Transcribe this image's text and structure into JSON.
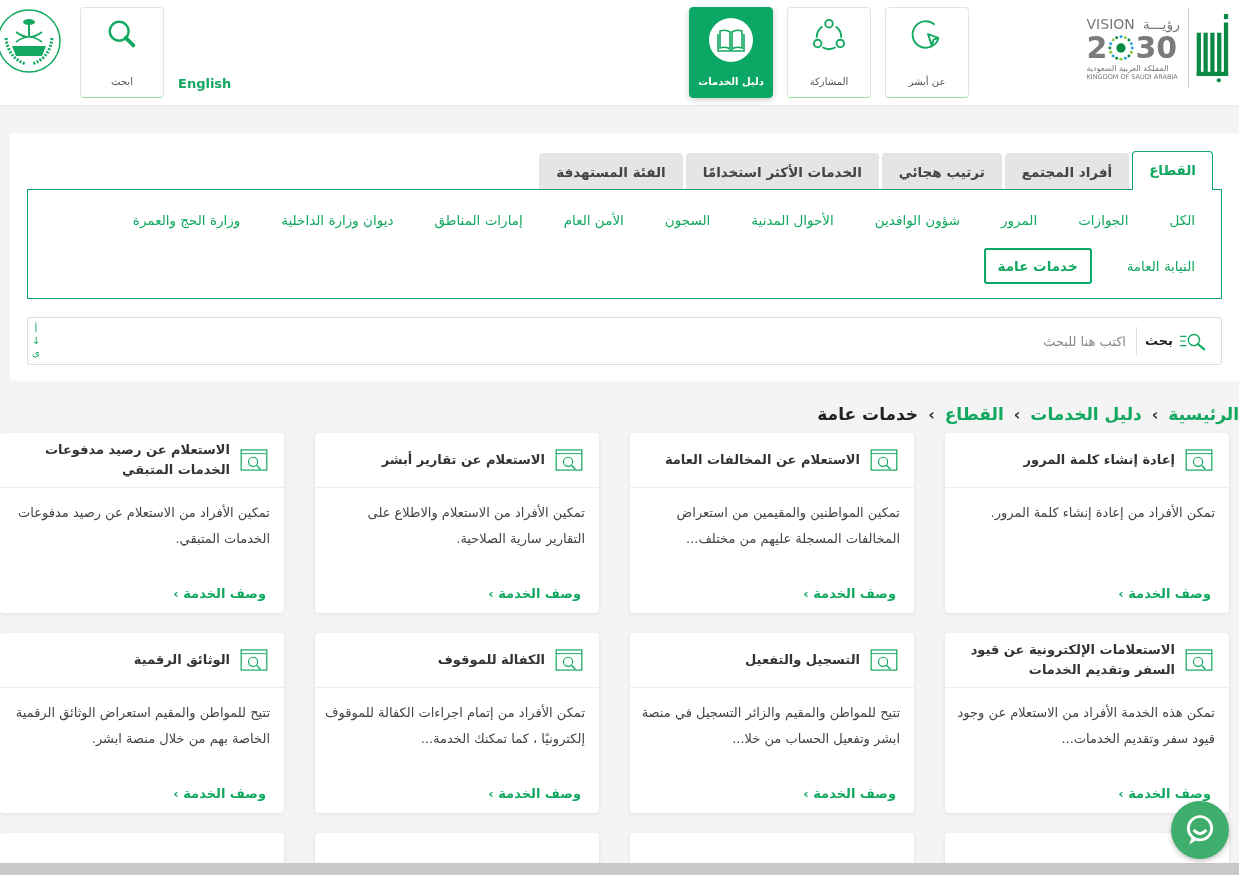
{
  "header": {
    "logo": {
      "vision_word": "VISION",
      "vision_arabic": "رؤيـــة",
      "year_start": "2",
      "year_end": "30",
      "country_arabic": "المملكة العربية السعودية",
      "country_english": "KINGDOM OF SAUDI ARABIA"
    },
    "nav": [
      {
        "label": "عن أبشر",
        "kind": "cursor",
        "selected": false
      },
      {
        "label": "المشاركة",
        "kind": "share",
        "selected": false
      },
      {
        "label": "دليل الخدمات",
        "kind": "book",
        "selected": true
      }
    ],
    "language_link": "English",
    "search_button": "ابحث"
  },
  "tabs": [
    {
      "label": "القطاع",
      "selected": true
    },
    {
      "label": "أفراد المجتمع",
      "selected": false
    },
    {
      "label": "ترتيب هجائي",
      "selected": false
    },
    {
      "label": "الخدمات الأكثر استخدامًا",
      "selected": false
    },
    {
      "label": "الفئة المستهدفة",
      "selected": false
    }
  ],
  "sectors": [
    {
      "label": "الكل",
      "selected": false
    },
    {
      "label": "الجوازات",
      "selected": false
    },
    {
      "label": "المرور",
      "selected": false
    },
    {
      "label": "شؤون الوافدين",
      "selected": false
    },
    {
      "label": "الأحوال المدنية",
      "selected": false
    },
    {
      "label": "السجون",
      "selected": false
    },
    {
      "label": "الأمن العام",
      "selected": false
    },
    {
      "label": "إمارات المناطق",
      "selected": false
    },
    {
      "label": "ديوان وزارة الداخلية",
      "selected": false
    },
    {
      "label": "وزارة الحج والعمرة",
      "selected": false
    },
    {
      "label": "النيابة العامة",
      "selected": false
    },
    {
      "label": "خدمات عامة",
      "selected": true
    }
  ],
  "search": {
    "label": "بحث",
    "placeholder": "اكتب هنا للبحث",
    "sort": [
      "أ",
      "↓",
      "ى"
    ]
  },
  "breadcrumb": [
    {
      "label": "الرئيسية",
      "current": false
    },
    {
      "label": "دليل الخدمات",
      "current": false
    },
    {
      "label": "القطاع",
      "current": false
    },
    {
      "label": "خدمات عامة",
      "current": true
    }
  ],
  "breadcrumb_separator": "›",
  "cards": [
    {
      "title": "إعادة إنشاء كلمة المرور",
      "description": "تمكن الأفراد من إعادة إنشاء كلمة المرور.",
      "link": "وصف الخدمة ›"
    },
    {
      "title": "الاستعلام عن المخالفات العامة",
      "description": "تمكين المواطنين والمقيمين من استعراض المخالفات المسجلة عليهم من مختلف...",
      "link": "وصف الخدمة ›"
    },
    {
      "title": "الاستعلام عن تقارير أبشر",
      "description": "تمكين الأفراد من الاستعلام والاطلاع على التقارير سارية الصلاحية.",
      "link": "وصف الخدمة ›"
    },
    {
      "title": "الاستعلام عن رصيد مدفوعات الخدمات المتبقي",
      "description": "تمكين الأفراد من الاستعلام عن رصيد مدفوعات الخدمات المتبقي.",
      "link": "وصف الخدمة ›"
    },
    {
      "title": "الاستعلامات الإلكترونية عن قيود السفر وتقديم الخدمات",
      "description": "تمكن هذه الخدمة الأفراد من الاستعلام عن وجود قيود سفر وتقديم الخدمات...",
      "link": "وصف الخدمة ›"
    },
    {
      "title": "التسجيل والتفعيل",
      "description": "تتيح للمواطن والمقيم والزائر التسجيل في منصة ابشر وتفعيل الحساب من خلا...",
      "link": "وصف الخدمة ›"
    },
    {
      "title": "الكفالة للموقوف",
      "description": "تمكن الأفراد من إتمام اجراءات الكفالة للموقوف إلكترونيًا ، كما تمكنك الخدمة...",
      "link": "وصف الخدمة ›"
    },
    {
      "title": "الوثائق الرقمية",
      "description": "تتيح للمواطن والمقيم استعراض الوثائق الرقمية الخاصة بهم من خلال منصة ابشر.",
      "link": "وصف الخدمة ›"
    }
  ]
}
